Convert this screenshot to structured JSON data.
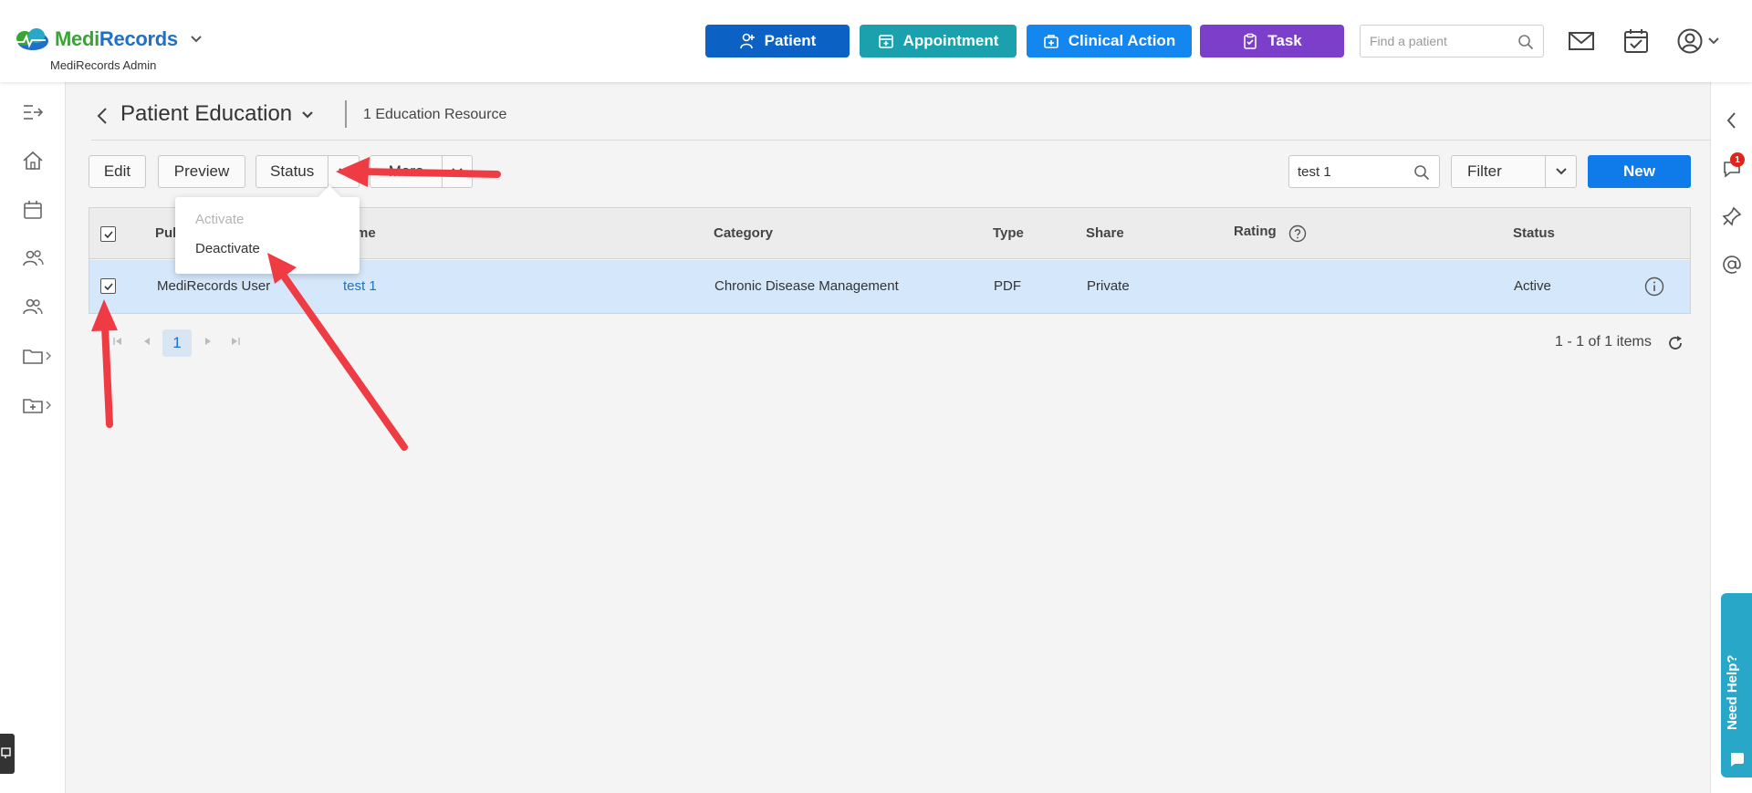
{
  "header": {
    "logo_medi": "Medi",
    "logo_records": "Records",
    "logo_sub": "MediRecords Admin",
    "quick_buttons": {
      "patient": "Patient",
      "appointment": "Appointment",
      "clinical_action": "Clinical Action",
      "task": "Task"
    },
    "find_placeholder": "Find a patient"
  },
  "page": {
    "title": "Patient Education",
    "resource_count": "1 Education Resource"
  },
  "toolbar": {
    "edit": "Edit",
    "preview": "Preview",
    "status": "Status",
    "more": "More",
    "search_value": "test 1",
    "filter": "Filter",
    "new": "New"
  },
  "status_menu": {
    "items": [
      {
        "label": "Activate",
        "enabled": false
      },
      {
        "label": "Deactivate",
        "enabled": true
      }
    ]
  },
  "grid": {
    "columns": [
      "Pub",
      "me",
      "Category",
      "Type",
      "Share",
      "Rating",
      "Status"
    ],
    "rows": [
      {
        "publisher": "MediRecords User",
        "name": "test 1",
        "category": "Chronic Disease Management",
        "type": "PDF",
        "share": "Private",
        "rating": "",
        "status": "Active",
        "selected": true
      }
    ]
  },
  "pager": {
    "current_page": "1",
    "summary": "1 - 1 of 1 items"
  },
  "right_sidebar": {
    "notification_count": "1",
    "need_help": "Need Help?"
  },
  "colors": {
    "patient": "#0b62c4",
    "appointment": "#1aa1ad",
    "clinical_action": "#1486f0",
    "task": "#7b3fc9",
    "new": "#0f7bea",
    "selected_row": "#d5e7fa",
    "annotation_arrow": "#ee3b44"
  }
}
